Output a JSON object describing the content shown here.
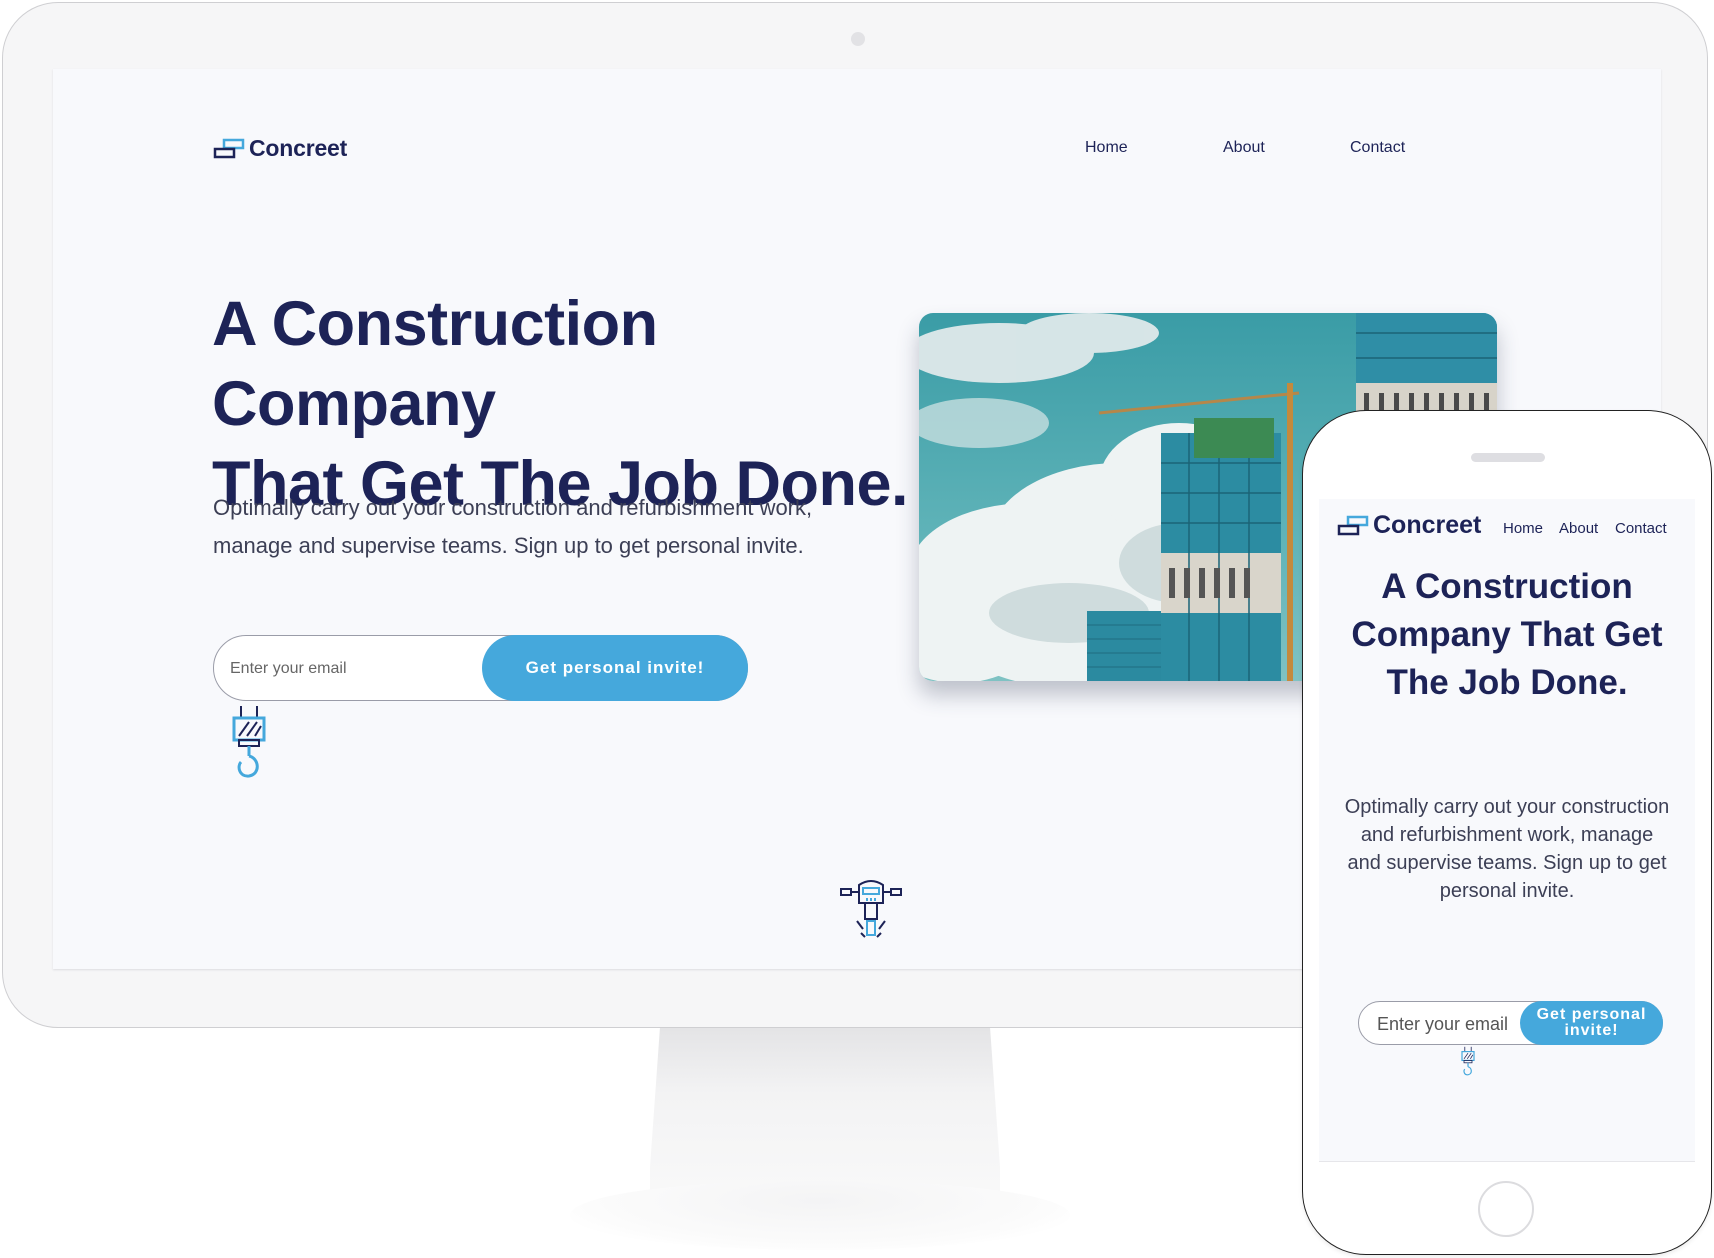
{
  "brand": {
    "name": "Concreet",
    "logo_icon": "stacked-bricks-icon"
  },
  "nav": {
    "home": "Home",
    "about": "About",
    "contact": "Contact"
  },
  "hero": {
    "title_line1": "A Construction Company",
    "title_line2": "That Get The Job Done.",
    "description_line1": "Optimally carry out your construction and refurbishment work,",
    "description_line2": "manage and supervise teams. Sign up to get personal invite.",
    "image_alt": "Building under construction with cranes and clouds"
  },
  "signup": {
    "email_placeholder": "Enter your email",
    "button_label": "Get personal invite!"
  },
  "mobile": {
    "title": "A Construction Company That Get The Job Done.",
    "description": "Optimally carry out your construction and refurbishment work, manage and supervise teams. Sign up to get personal invite.",
    "button_line1": "Get personal",
    "button_line2": "invite!"
  },
  "icons": [
    "crane-hook-icon",
    "jackhammer-icon"
  ],
  "colors": {
    "brand_navy": "#1d2357",
    "accent_blue": "#45a8dc",
    "background": "#f8f9fc"
  }
}
